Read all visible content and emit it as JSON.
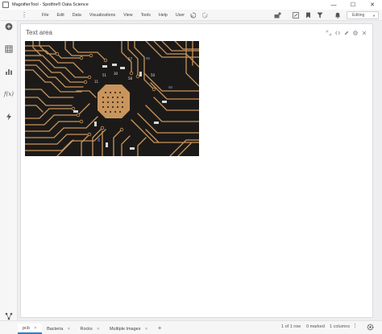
{
  "window": {
    "title": "MagnifierTool - Spotfire® Data Science",
    "minimize_glyph": "—",
    "maximize_glyph": "☐",
    "close_glyph": "✕"
  },
  "menu": {
    "overflow_glyph": "⋮",
    "items": [
      "File",
      "Edit",
      "Data",
      "Visualizations",
      "View",
      "Tools",
      "Help",
      "User"
    ],
    "mode": "Editing"
  },
  "toolbar": {
    "icons": [
      "undo-icon",
      "redo-icon",
      "collaboration-icon",
      "presentation-icon",
      "bookmark-icon",
      "filter-icon",
      "notification-icon"
    ]
  },
  "sidebar": {
    "icons": [
      "add-icon",
      "data-table-icon",
      "visualization-icon",
      "fx-icon",
      "lightning-icon",
      "data-flow-icon"
    ],
    "fx_label": "f(x)"
  },
  "panel": {
    "title": "Text area",
    "image_alt": "pcb circuit board"
  },
  "tabs": [
    {
      "label": "pcb",
      "active": true
    },
    {
      "label": "Bacteria",
      "active": false
    },
    {
      "label": "Rocks",
      "active": false
    },
    {
      "label": "Multiple Images",
      "active": false
    }
  ],
  "add_tab_glyph": "+",
  "status": {
    "rows": "1 of 1 row",
    "marked": "0 marked",
    "columns": "1 columns"
  },
  "colors": {
    "accent": "#3a7cc2",
    "pcb_board": "#1c1a18",
    "pcb_copper": "#c9955c"
  }
}
